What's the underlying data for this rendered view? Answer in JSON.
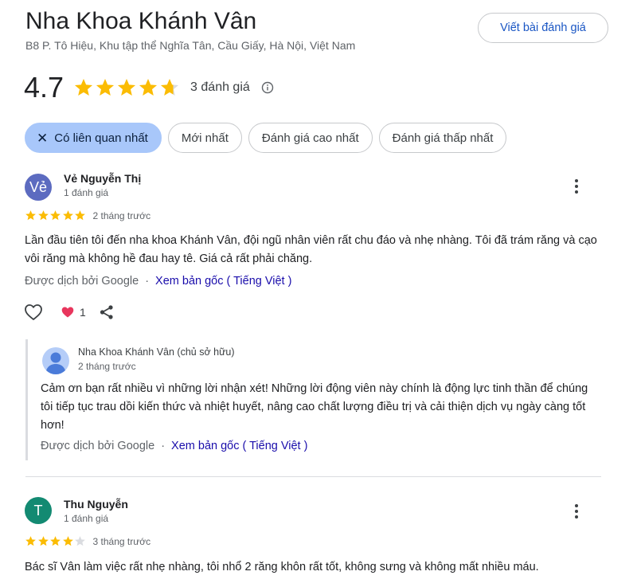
{
  "business": {
    "name": "Nha Khoa Khánh Vân",
    "address": "B8 P. Tô Hiệu, Khu tập thể Nghĩa Tân, Cầu Giấy, Hà Nội, Việt Nam",
    "write_review_label": "Viết bài đánh giá",
    "rating": "4.7",
    "rating_stars": 4.7,
    "review_count_label": "3 đánh giá"
  },
  "filters": [
    {
      "label": "Có liên quan nhất",
      "active": true
    },
    {
      "label": "Mới nhất",
      "active": false
    },
    {
      "label": "Đánh giá cao nhất",
      "active": false
    },
    {
      "label": "Đánh giá thấp nhất",
      "active": false
    }
  ],
  "reviews": [
    {
      "avatar_text": "Vẻ",
      "avatar_color": "#5c6bc0",
      "author": "Vẻ Nguyễn Thị",
      "author_meta": "1 đánh giá",
      "stars": 5,
      "time": "2 tháng trước",
      "text": "Lần đầu tiên tôi đến nha khoa Khánh Vân, đội ngũ nhân viên rất chu đáo và nhẹ nhàng. Tôi đã trám răng và cạo vôi răng mà không hề đau hay tê. Giá cả rất phải chăng.",
      "translated_by": "Được dịch bởi Google",
      "separator": "·",
      "view_original": "Xem bản gốc ( Tiếng Việt )",
      "reaction_count": "1",
      "reply": {
        "author": "Nha Khoa Khánh Vân (chủ sở hữu)",
        "time": "2 tháng trước",
        "text": "Cảm ơn bạn rất nhiều vì những lời nhận xét! Những lời động viên này chính là động lực tinh thần để chúng tôi tiếp tục trau dồi kiến thức và nhiệt huyết, nâng cao chất lượng điều trị và cải thiện dịch vụ ngày càng tốt hơn!",
        "translated_by": "Được dịch bởi Google",
        "separator": "·",
        "view_original": "Xem bản gốc ( Tiếng Việt )"
      }
    },
    {
      "avatar_text": "T",
      "avatar_color": "#138a72",
      "author": "Thu Nguyễn",
      "author_meta": "1 đánh giá",
      "stars": 4,
      "time": "3 tháng trước",
      "text": "Bác sĩ Vân làm việc rất nhẹ nhàng, tôi nhổ 2 răng khôn rất tốt, không sưng và không mất nhiều máu."
    }
  ],
  "colors": {
    "star_filled": "#fbbc04",
    "star_empty": "#dadce0",
    "link": "#1a0dab",
    "chip_active": "#a8c7fa"
  },
  "icons": [
    "info-icon",
    "close-icon",
    "heart-outline-icon",
    "heart-filled-icon",
    "share-icon",
    "more-vert-icon",
    "person-icon",
    "star-icon"
  ]
}
